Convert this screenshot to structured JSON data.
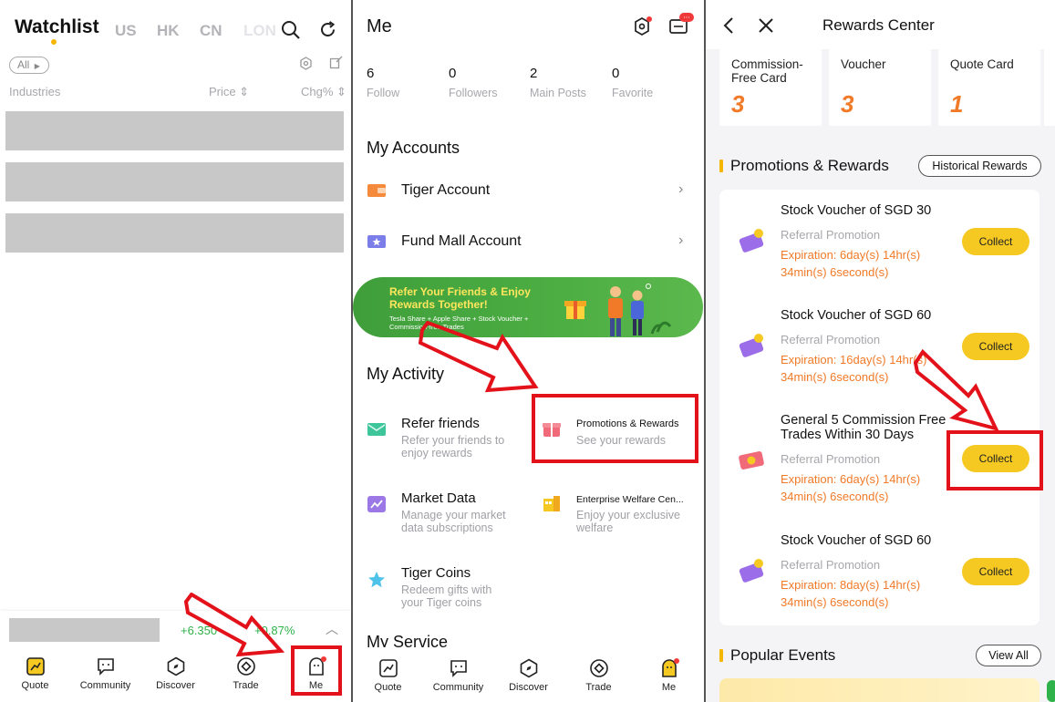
{
  "panel1": {
    "title": "Watchlist",
    "market_tabs": [
      "US",
      "HK",
      "CN",
      "LON"
    ],
    "filter_label": "All",
    "columns": {
      "industries": "Industries",
      "price": "Price ⇕",
      "chg": "Chg% ⇕"
    },
    "ticker": {
      "change": "+6.350",
      "pct": "+0.87%"
    },
    "tabbar": [
      "Quote",
      "Community",
      "Discover",
      "Trade",
      "Me"
    ]
  },
  "panel2": {
    "title": "Me",
    "stats": [
      {
        "num": "6",
        "label": "Follow"
      },
      {
        "num": "0",
        "label": "Followers"
      },
      {
        "num": "2",
        "label": "Main Posts"
      },
      {
        "num": "0",
        "label": "Favorite"
      }
    ],
    "accounts_title": "My Accounts",
    "accounts": [
      "Tiger Account",
      "Fund Mall Account"
    ],
    "banner": {
      "headline": "Refer Your Friends & Enjoy Rewards Together!",
      "sub": "Tesla Share + Apple Share + Stock Voucher + Commission-free Trades"
    },
    "activity_title": "My Activity",
    "activities": [
      {
        "title": "Refer friends",
        "sub": "Refer your friends to enjoy rewards"
      },
      {
        "title": "Promotions & Rewards",
        "sub": "See your rewards"
      },
      {
        "title": "Market Data",
        "sub": "Manage your market data subscriptions"
      },
      {
        "title": "Enterprise Welfare Cen...",
        "sub": "Enjoy your exclusive welfare"
      },
      {
        "title": "Tiger Coins",
        "sub": "Redeem gifts with your Tiger coins"
      }
    ],
    "service_title": "My Service",
    "tabbar": [
      "Quote",
      "Community",
      "Discover",
      "Trade",
      "Me"
    ]
  },
  "panel3": {
    "title": "Rewards Center",
    "top_cards": [
      {
        "label": "Commission-Free Card",
        "count": "3"
      },
      {
        "label": "Voucher",
        "count": "3"
      },
      {
        "label": "Quote Card",
        "count": "1"
      }
    ],
    "promotions_title": "Promotions & Rewards",
    "historical_btn": "Historical Rewards",
    "vouchers": [
      {
        "title": "Stock Voucher of SGD 30",
        "type": "Referral Promotion",
        "exp1": "Expiration: 6day(s) 14hr(s)",
        "exp2": "34min(s) 6second(s)",
        "btn": "Collect"
      },
      {
        "title": "Stock Voucher of SGD 60",
        "type": "Referral Promotion",
        "exp1": "Expiration: 16day(s) 14hr(s)",
        "exp2": "34min(s) 6second(s)",
        "btn": "Collect"
      },
      {
        "title": "General 5 Commission Free Trades Within 30 Days",
        "type": "Referral Promotion",
        "exp1": "Expiration: 6day(s) 14hr(s)",
        "exp2": "34min(s) 6second(s)",
        "btn": "Collect"
      },
      {
        "title": "Stock Voucher of SGD 60",
        "type": "Referral Promotion",
        "exp1": "Expiration: 8day(s) 14hr(s)",
        "exp2": "34min(s) 6second(s)",
        "btn": "Collect"
      }
    ],
    "popular_title": "Popular Events",
    "view_all": "View All"
  },
  "colors": {
    "accent_yellow": "#f5c922",
    "expiry_orange": "#f07a28",
    "annotation_red": "#e3121a",
    "gain_green": "#2fb24a"
  }
}
